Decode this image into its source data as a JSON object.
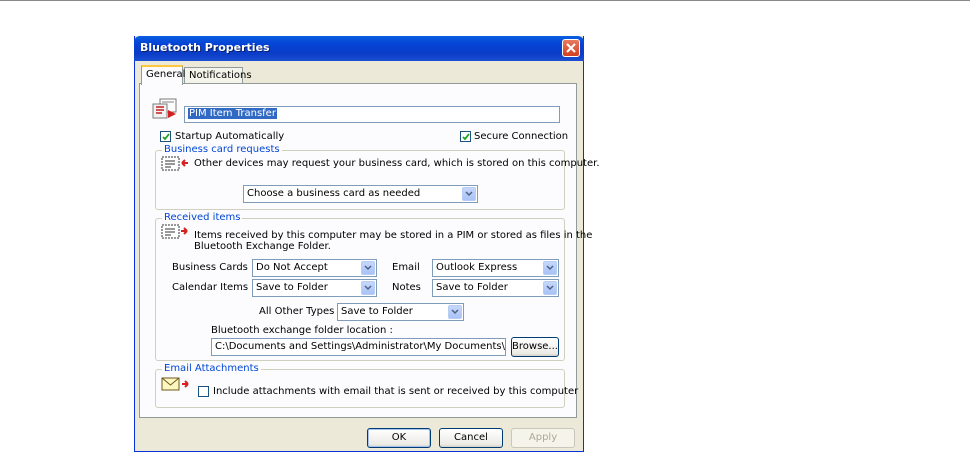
{
  "window": {
    "title": "Bluetooth Properties"
  },
  "tabs": [
    {
      "label": "General"
    },
    {
      "label": "Notifications"
    }
  ],
  "general": {
    "service_name": "PIM Item Transfer",
    "startup_automatically": {
      "label": "Startup Automatically",
      "checked": true
    },
    "secure_connection": {
      "label": "Secure Connection",
      "checked": true
    }
  },
  "business_card_requests": {
    "title": "Business card requests",
    "description": "Other devices may request your business card, which is stored on this computer.",
    "selected": "Choose a business card as needed"
  },
  "received_items": {
    "title": "Received items",
    "description_line1": "Items received by this computer may be stored in a PIM or stored as files in the",
    "description_line2": "Bluetooth Exchange Folder.",
    "business_cards": {
      "label": "Business Cards",
      "value": "Do Not Accept"
    },
    "calendar_items": {
      "label": "Calendar Items",
      "value": "Save to Folder"
    },
    "email": {
      "label": "Email",
      "value": "Outlook Express"
    },
    "notes": {
      "label": "Notes",
      "value": "Save to Folder"
    },
    "all_other_types": {
      "label": "All Other Types",
      "value": "Save to Folder"
    },
    "folder_location_label": "Bluetooth exchange folder location :",
    "folder_location_value": "C:\\Documents and Settings\\Administrator\\My Documents\\Bluetooth",
    "browse_label": "Browse..."
  },
  "email_attachments": {
    "title": "Email Attachments",
    "include_label": "Include attachments with email that is sent or received by this computer",
    "checked": false
  },
  "buttons": {
    "ok": "OK",
    "cancel": "Cancel",
    "apply": "Apply"
  },
  "colors": {
    "titlebar": "#0443d6",
    "group_title": "#0046d5",
    "close_button": "#d2401f",
    "dialog_background": "#ece9d8"
  }
}
